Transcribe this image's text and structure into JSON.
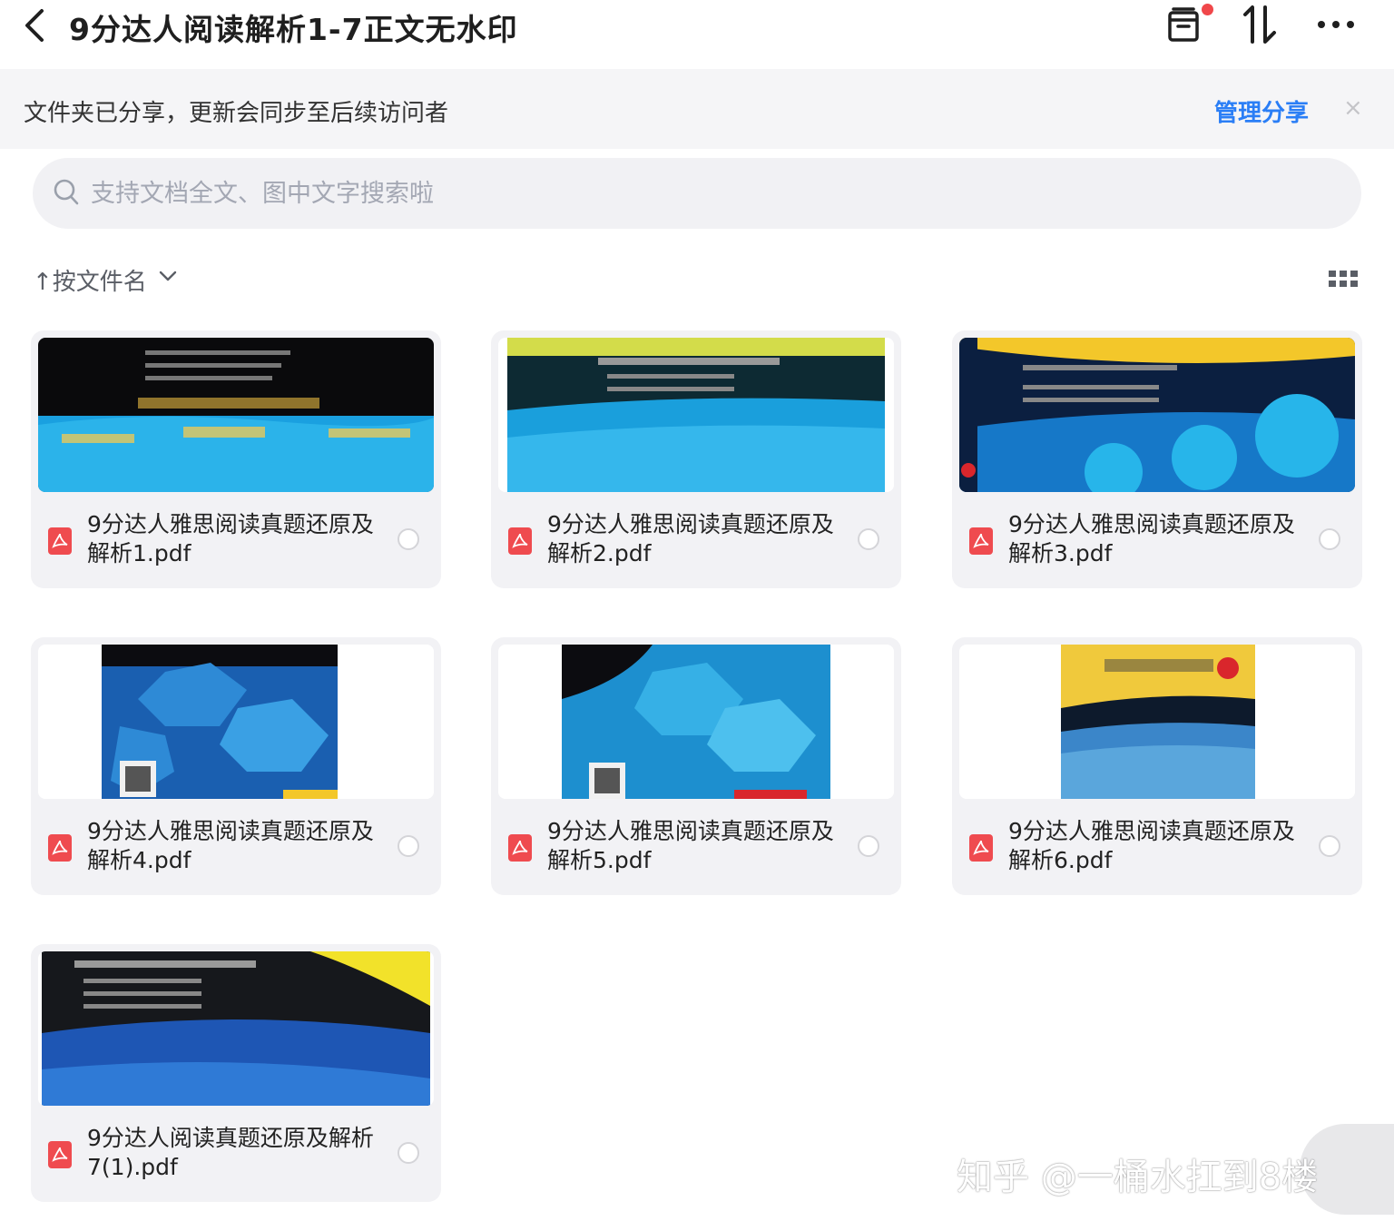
{
  "header": {
    "title": "9分达人阅读解析1-7正文无水印",
    "icons": [
      "back-chevron-icon",
      "archive-box-icon",
      "sort-arrows-icon",
      "more-dots-icon"
    ],
    "notification_dot_color": "#f0474a"
  },
  "banner": {
    "text": "文件夹已分享，更新会同步至后续访问者",
    "action_label": "管理分享",
    "close_glyph": "×"
  },
  "search": {
    "placeholder": "支持文档全文、图中文字搜索啦"
  },
  "toolbar": {
    "sort_label": "↑按文件名",
    "view_icon": "grid-view-icon"
  },
  "files": [
    {
      "name": "9分达人雅思阅读真题还原及解析1.pdf",
      "icon": "pdf-icon"
    },
    {
      "name": "9分达人雅思阅读真题还原及解析2.pdf",
      "icon": "pdf-icon"
    },
    {
      "name": "9分达人雅思阅读真题还原及解析3.pdf",
      "icon": "pdf-icon"
    },
    {
      "name": "9分达人雅思阅读真题还原及解析4.pdf",
      "icon": "pdf-icon"
    },
    {
      "name": "9分达人雅思阅读真题还原及解析5.pdf",
      "icon": "pdf-icon"
    },
    {
      "name": "9分达人雅思阅读真题还原及解析6.pdf",
      "icon": "pdf-icon"
    },
    {
      "name": "9分达人阅读真题还原及解析7(1).pdf",
      "icon": "pdf-icon"
    }
  ],
  "watermark": "知乎 @一桶水扛到8楼",
  "colors": {
    "accent": "#2a7ef6",
    "pdf_red": "#ef4b4f",
    "card_bg": "#f2f2f5"
  }
}
